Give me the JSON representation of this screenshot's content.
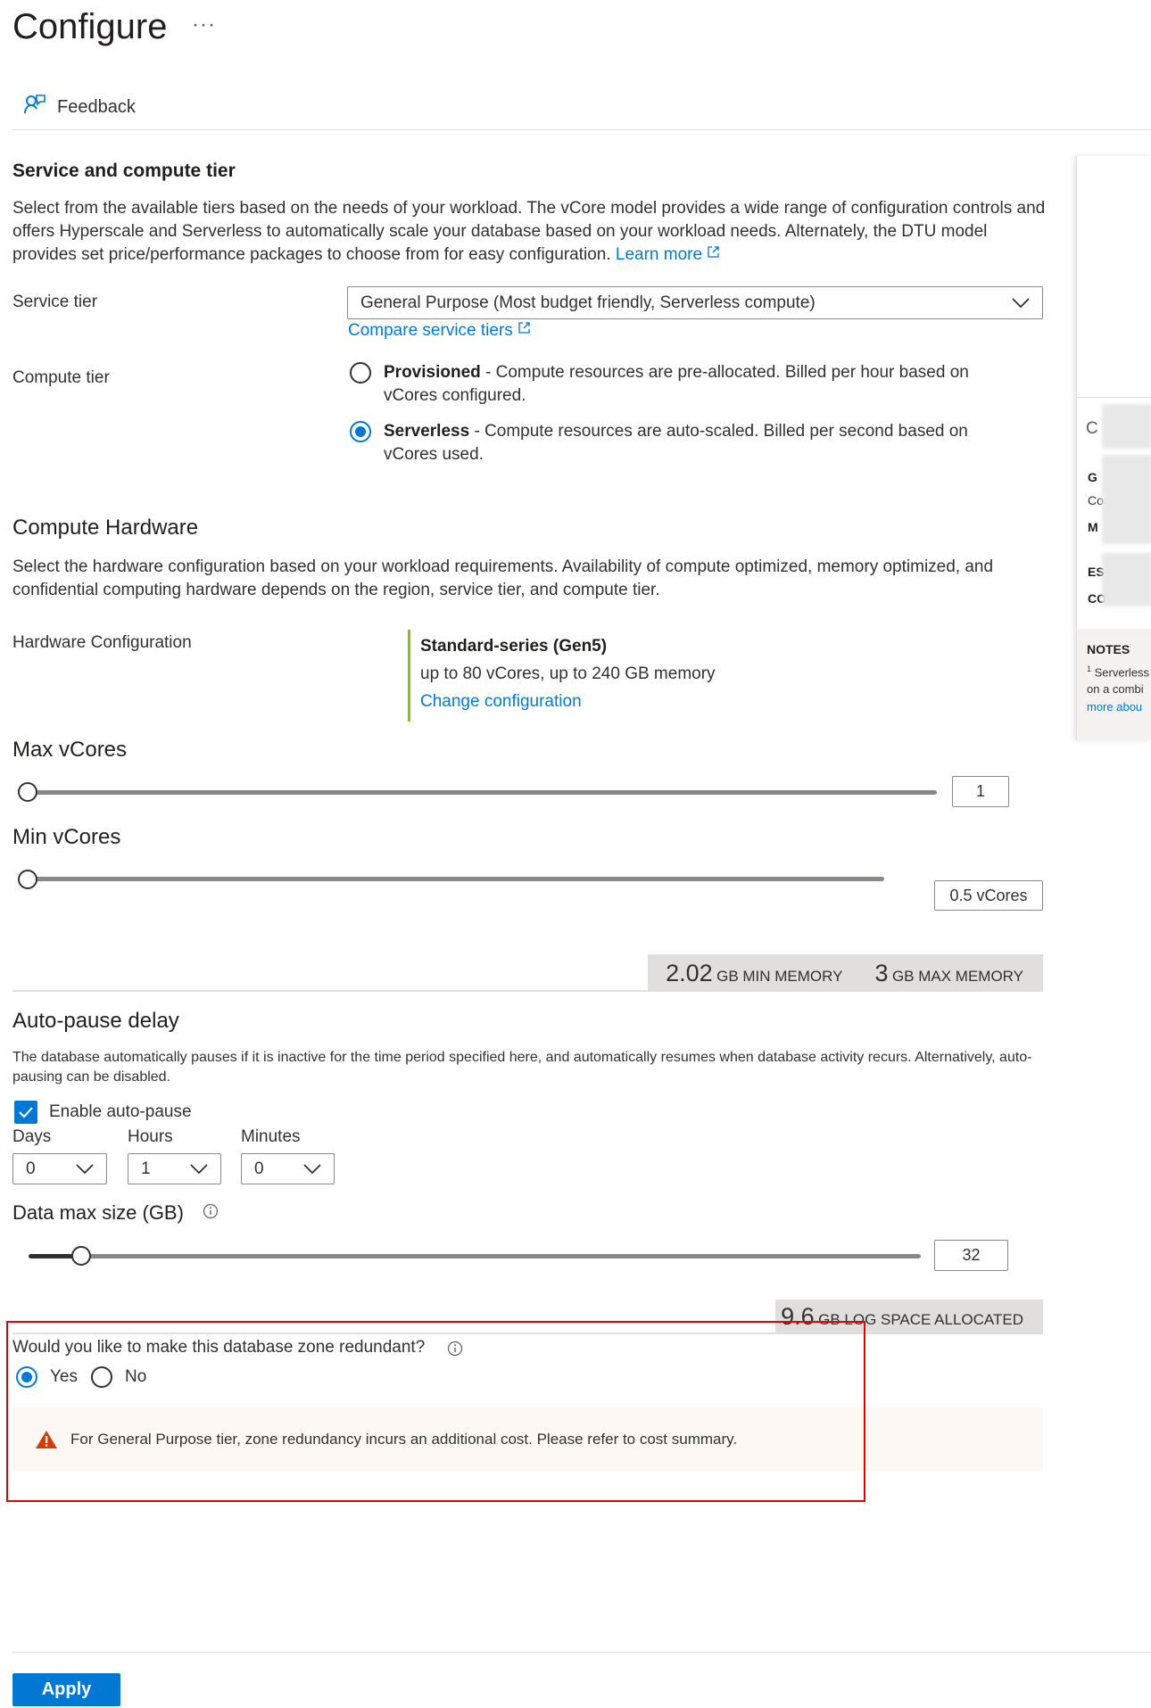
{
  "header": {
    "title": "Configure",
    "more": "···",
    "feedback": "Feedback"
  },
  "service": {
    "heading": "Service and compute tier",
    "description": "Select from the available tiers based on the needs of your workload. The vCore model provides a wide range of configuration controls and offers Hyperscale and Serverless to automatically scale your database based on your workload needs. Alternately, the DTU model provides set price/performance packages to choose from for easy configuration.",
    "learn_more": "Learn more",
    "tier_label": "Service tier",
    "tier_value": "General Purpose (Most budget friendly, Serverless compute)",
    "compare_link": "Compare service tiers",
    "compute_label": "Compute tier",
    "provisioned_title": "Provisioned",
    "provisioned_desc": "- Compute resources are pre-allocated. Billed per hour based on vCores configured.",
    "serverless_title": "Serverless",
    "serverless_desc": "- Compute resources are auto-scaled. Billed per second based on vCores used.",
    "selected": "Serverless"
  },
  "hardware": {
    "heading": "Compute Hardware",
    "description": "Select the hardware configuration based on your workload requirements. Availability of compute optimized, memory optimized, and confidential computing hardware depends on the region, service tier, and compute tier.",
    "config_label": "Hardware Configuration",
    "series": "Standard-series (Gen5)",
    "specs": "up to 80 vCores, up to 240 GB memory",
    "change_link": "Change configuration"
  },
  "vcores": {
    "max_label": "Max vCores",
    "max_value": "1",
    "min_label": "Min vCores",
    "min_value": "0.5 vCores",
    "min_memory": "2.02",
    "min_memory_label": "GB MIN MEMORY",
    "max_memory": "3",
    "max_memory_label": "GB MAX MEMORY"
  },
  "autopause": {
    "heading": "Auto-pause delay",
    "description": "The database automatically pauses if it is inactive for the time period specified here, and automatically resumes when database activity recurs. Alternatively, auto-pausing can be disabled.",
    "enable_label": "Enable auto-pause",
    "enabled": true,
    "days_label": "Days",
    "days_value": "0",
    "hours_label": "Hours",
    "hours_value": "1",
    "minutes_label": "Minutes",
    "minutes_value": "0"
  },
  "datasize": {
    "label": "Data max size (GB)",
    "value": "32",
    "log_space": "9.6",
    "log_label": "GB LOG SPACE ALLOCATED"
  },
  "zone": {
    "question": "Would you like to make this database zone redundant?",
    "yes": "Yes",
    "no": "No",
    "selected": "Yes",
    "warning": "For General Purpose tier, zone redundancy incurs an additional cost. Please refer to cost summary."
  },
  "side_panel": {
    "notes_heading": "NOTES",
    "note_line1": "Serverless",
    "note_line2": "on a combi",
    "note_link": "more abou",
    "frag_c": "C",
    "frag_g": "G",
    "frag_co": "Co",
    "frag_m": "M",
    "frag_es": "ES",
    "frag_co2": "CO"
  },
  "footer": {
    "apply": "Apply"
  },
  "colors": {
    "accent": "#0078d4",
    "warning": "#d83b01",
    "highlight": "#e00000"
  }
}
